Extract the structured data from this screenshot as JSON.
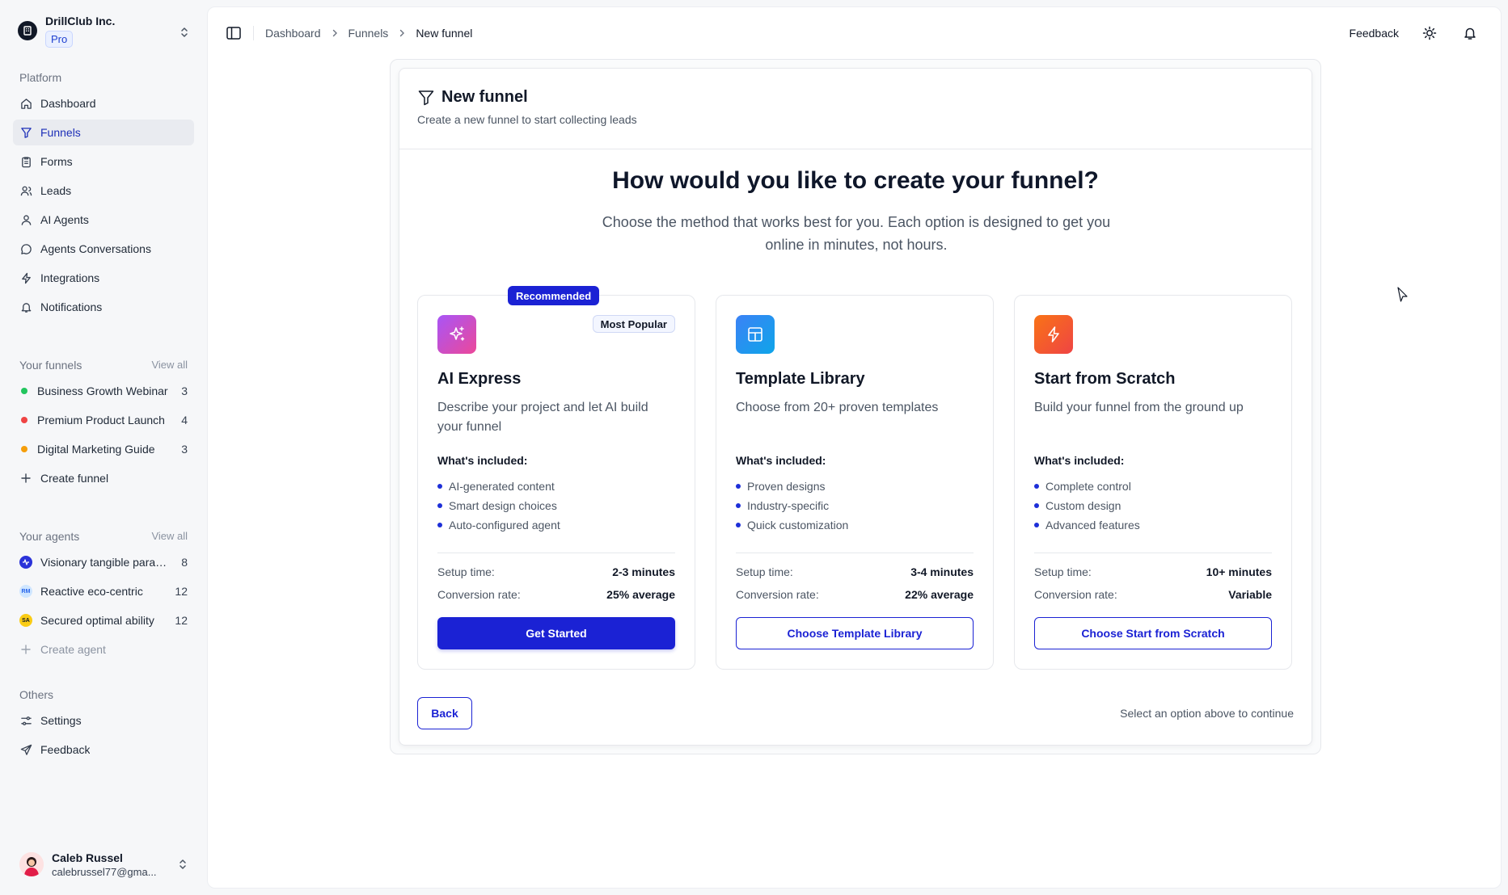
{
  "org": {
    "name": "DrillClub Inc.",
    "plan": "Pro"
  },
  "nav": {
    "platform_label": "Platform",
    "items": [
      {
        "label": "Dashboard",
        "icon": "home-icon"
      },
      {
        "label": "Funnels",
        "icon": "funnel-icon"
      },
      {
        "label": "Forms",
        "icon": "clipboard-icon"
      },
      {
        "label": "Leads",
        "icon": "users-icon"
      },
      {
        "label": "AI Agents",
        "icon": "bot-icon"
      },
      {
        "label": "Agents Conversations",
        "icon": "chat-icon"
      },
      {
        "label": "Integrations",
        "icon": "bolt-icon"
      },
      {
        "label": "Notifications",
        "icon": "bell-icon"
      }
    ],
    "active": "Funnels"
  },
  "funnels": {
    "label": "Your funnels",
    "view_all": "View all",
    "items": [
      {
        "name": "Business Growth Webinar",
        "count": "3",
        "color": "#22c55e"
      },
      {
        "name": "Premium Product Launch",
        "count": "4",
        "color": "#ef4444"
      },
      {
        "name": "Digital Marketing Guide",
        "count": "3",
        "color": "#f59e0b"
      }
    ],
    "create": "Create funnel"
  },
  "agents": {
    "label": "Your agents",
    "view_all": "View all",
    "items": [
      {
        "name": "Visionary tangible paradigm",
        "count": "8",
        "avatar": ""
      },
      {
        "name": "Reactive eco-centric",
        "count": "12",
        "avatar": "RM"
      },
      {
        "name": "Secured optimal ability",
        "count": "12",
        "avatar": "SA"
      }
    ],
    "create": "Create agent"
  },
  "others": {
    "label": "Others",
    "items": [
      {
        "label": "Settings",
        "icon": "sliders-icon"
      },
      {
        "label": "Feedback",
        "icon": "send-icon"
      }
    ]
  },
  "user": {
    "name": "Caleb Russel",
    "email": "calebrussel77@gma..."
  },
  "topbar": {
    "breadcrumbs": [
      "Dashboard",
      "Funnels",
      "New funnel"
    ],
    "feedback": "Feedback"
  },
  "card": {
    "title": "New funnel",
    "subtitle": "Create a new funnel to start collecting leads",
    "hero_title": "How would you like to create your funnel?",
    "hero_subtitle": "Choose the method that works best for you. Each option is designed to get you online in minutes, not hours."
  },
  "options": [
    {
      "title": "AI Express",
      "description": "Describe your project and let AI build your funnel",
      "badge": "Recommended",
      "tag": "Most Popular",
      "included_label": "What's included:",
      "features": [
        "AI-generated content",
        "Smart design choices",
        "Auto-configured agent"
      ],
      "setup_label": "Setup time:",
      "setup_value": "2-3 minutes",
      "conversion_label": "Conversion rate:",
      "conversion_value": "25% average",
      "button": "Get Started",
      "icon": "sparkles-icon"
    },
    {
      "title": "Template Library",
      "description": "Choose from 20+ proven templates",
      "included_label": "What's included:",
      "features": [
        "Proven designs",
        "Industry-specific",
        "Quick customization"
      ],
      "setup_label": "Setup time:",
      "setup_value": "3-4 minutes",
      "conversion_label": "Conversion rate:",
      "conversion_value": "22% average",
      "button": "Choose Template Library",
      "icon": "layout-icon"
    },
    {
      "title": "Start from Scratch",
      "description": "Build your funnel from the ground up",
      "included_label": "What's included:",
      "features": [
        "Complete control",
        "Custom design",
        "Advanced features"
      ],
      "setup_label": "Setup time:",
      "setup_value": "10+ minutes",
      "conversion_label": "Conversion rate:",
      "conversion_value": "Variable",
      "button": "Choose Start from Scratch",
      "icon": "lightning-icon"
    }
  ],
  "footer": {
    "back": "Back",
    "hint": "Select an option above to continue"
  },
  "colors": {
    "accent": "#1b22d4",
    "active_bg": "#e9ebf0"
  }
}
